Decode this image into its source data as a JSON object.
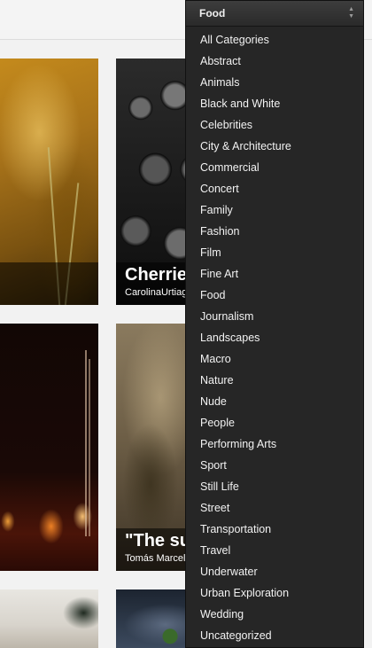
{
  "dropdown": {
    "selected": "Food",
    "options": [
      "All Categories",
      "Abstract",
      "Animals",
      "Black and White",
      "Celebrities",
      "City & Architecture",
      "Commercial",
      "Concert",
      "Family",
      "Fashion",
      "Film",
      "Fine Art",
      "Food",
      "Journalism",
      "Landscapes",
      "Macro",
      "Nature",
      "Nude",
      "People",
      "Performing Arts",
      "Sport",
      "Still Life",
      "Street",
      "Transportation",
      "Travel",
      "Underwater",
      "Urban Exploration",
      "Wedding",
      "Uncategorized"
    ],
    "arrow_icon": "sort-arrows-icon"
  },
  "gallery": {
    "tiles": [
      {
        "title": "",
        "author": ""
      },
      {
        "title": "Cherrie",
        "author": "CarolinaUrtiaga"
      },
      {
        "title": "",
        "author": ""
      },
      {
        "title": "\"The su",
        "author": "Tomás Marceli"
      },
      {
        "title": "",
        "author": ""
      },
      {
        "title": "",
        "author": ""
      }
    ]
  }
}
